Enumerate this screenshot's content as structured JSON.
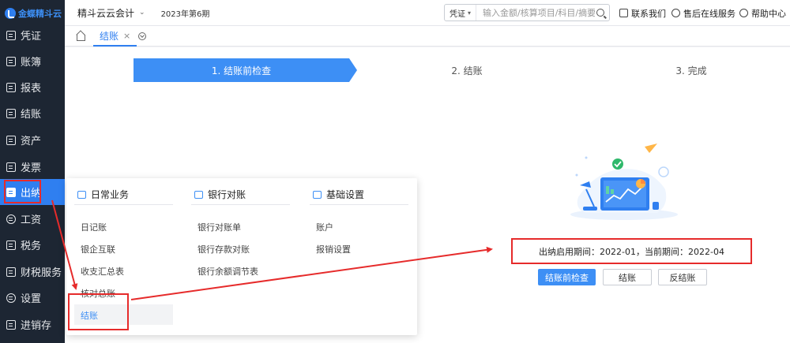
{
  "logo": {
    "text": "金蝶精斗云"
  },
  "sidebar": {
    "items": [
      {
        "label": "凭证"
      },
      {
        "label": "账簿"
      },
      {
        "label": "报表"
      },
      {
        "label": "结账"
      },
      {
        "label": "资产"
      },
      {
        "label": "发票"
      },
      {
        "label": "出纳"
      },
      {
        "label": "工资"
      },
      {
        "label": "税务"
      },
      {
        "label": "财税服务"
      },
      {
        "label": "设置"
      },
      {
        "label": "进销存"
      }
    ],
    "active": "出纳"
  },
  "topbar": {
    "company": "精斗云云会计",
    "period": "2023年第6期",
    "search_type": "凭证",
    "search_placeholder": "输入金额/核算项目/科目/摘要",
    "links": [
      "联系我们",
      "售后在线服务",
      "帮助中心"
    ]
  },
  "tabs": {
    "active_label": "结账",
    "close_glyph": "×"
  },
  "steps": [
    "1. 结账前检查",
    "2. 结账",
    "3. 完成"
  ],
  "info": {
    "text": "出纳启用期间：2022-01，当前期间：2022-04"
  },
  "buttons": {
    "precheck": "结账前检查",
    "close": "结账",
    "reverse": "反结账"
  },
  "dropdown": {
    "columns": [
      {
        "header": "日常业务",
        "items": [
          "日记账",
          "银企互联",
          "收支汇总表",
          "核对总账",
          "结账"
        ]
      },
      {
        "header": "银行对账",
        "items": [
          "银行对账单",
          "银行存款对账",
          "银行余额调节表"
        ]
      },
      {
        "header": "基础设置",
        "items": [
          "账户",
          "报销设置"
        ]
      }
    ]
  },
  "colors": {
    "accent": "#3d8ff5",
    "sidebar_bg": "#1d2633",
    "annotation_red": "#e62b2b"
  }
}
